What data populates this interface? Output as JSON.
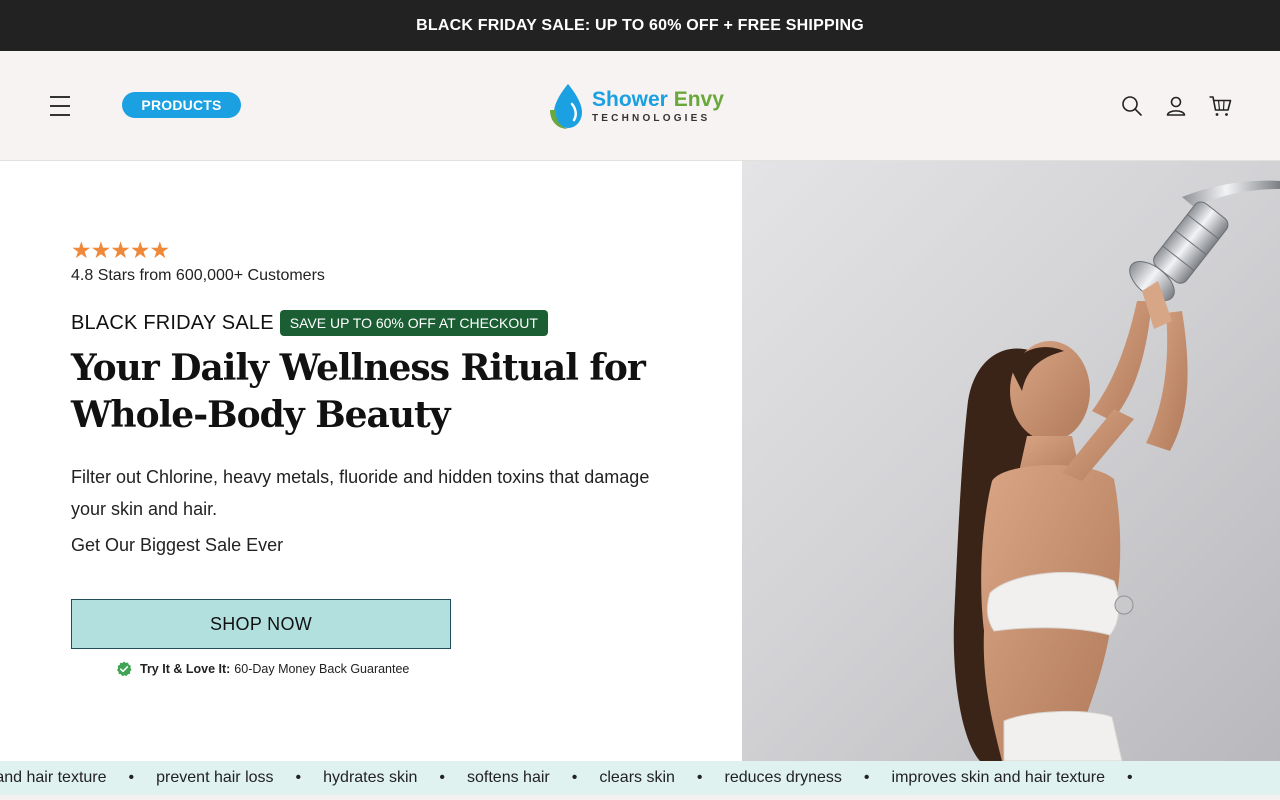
{
  "announcement": {
    "text": "BLACK FRIDAY SALE: UP TO 60% OFF + FREE SHIPPING"
  },
  "header": {
    "products_label": "PRODUCTS",
    "logo": {
      "name_part1": "Shower",
      "name_part2": "Envy",
      "subtitle": "TECHNOLOGIES"
    },
    "icons": [
      "menu-icon",
      "search-icon",
      "account-icon",
      "cart-icon"
    ]
  },
  "hero": {
    "stars": "★★★★★",
    "rating": 4.8,
    "rating_text": "4.8 Stars from 600,000+ Customers",
    "sale_label": "BLACK FRIDAY SALE",
    "sale_badge": "SAVE UP TO 60% OFF AT CHECKOUT",
    "headline": "Your Daily Wellness Ritual for Whole-Body Beauty",
    "description": "Filter out Chlorine, heavy metals, fluoride and hidden toxins that damage your skin and hair.",
    "subtext": "Get Our Biggest Sale Ever",
    "cta_label": "SHOP NOW",
    "guarantee_bold": "Try It & Love It:",
    "guarantee_text": "60-Day Money Back Guarantee"
  },
  "ticker": {
    "items": [
      "n and hair texture",
      "prevent hair loss",
      "hydrates skin",
      "softens hair",
      "clears skin",
      "reduces dryness",
      "improves skin and hair texture"
    ],
    "separator": "•"
  },
  "colors": {
    "announcement_bg": "#222222",
    "header_bg": "#f6f3f2",
    "products_btn": "#1ba0e2",
    "logo_blue": "#1ba0e2",
    "logo_green": "#6aa83b",
    "stars": "#f0883a",
    "badge_bg": "#1b5e34",
    "cta_bg": "#b2e0df",
    "ticker_bg": "#dff2f0"
  }
}
